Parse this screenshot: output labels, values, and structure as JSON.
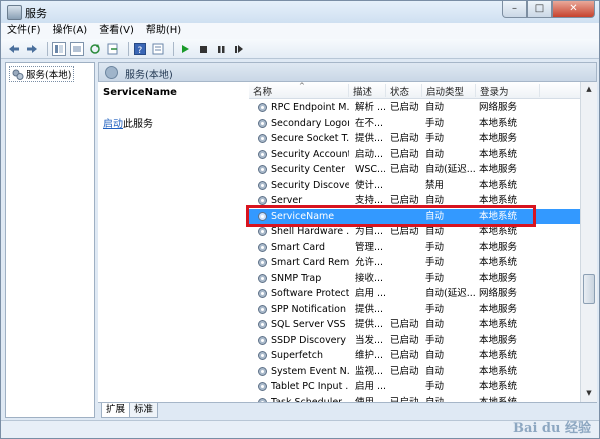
{
  "window": {
    "title": "服务",
    "min": "–",
    "max": "□",
    "close": "✕"
  },
  "menu": [
    "文件(F)",
    "操作(A)",
    "查看(V)",
    "帮助(H)"
  ],
  "toolbar_icons": [
    "back-icon",
    "forward-icon",
    "view-icon",
    "list-icon",
    "refresh-icon",
    "export-icon",
    "help-icon",
    "properties-icon",
    "play-icon",
    "stop-icon",
    "pause-icon",
    "restart-icon"
  ],
  "tree": {
    "root": "服务(本地)"
  },
  "right_header": "服务(本地)",
  "detail": {
    "service_name": "ServiceName",
    "start_link": "启动",
    "start_suffix": "此服务"
  },
  "columns": [
    "名称",
    "描述",
    "状态",
    "启动类型",
    "登录为"
  ],
  "rows": [
    {
      "name": "RPC Endpoint M...",
      "desc": "解析 ...",
      "status": "已启动",
      "type": "自动",
      "logon": "网络服务"
    },
    {
      "name": "Secondary Logon",
      "desc": "在不...",
      "status": "",
      "type": "手动",
      "logon": "本地系统"
    },
    {
      "name": "Secure Socket T...",
      "desc": "提供...",
      "status": "已启动",
      "type": "手动",
      "logon": "本地服务"
    },
    {
      "name": "Security Account...",
      "desc": "启动...",
      "status": "已启动",
      "type": "自动",
      "logon": "本地系统"
    },
    {
      "name": "Security Center",
      "desc": "WSC...",
      "status": "已启动",
      "type": "自动(延迟...",
      "logon": "本地服务"
    },
    {
      "name": "Security Discover...",
      "desc": "使计...",
      "status": "",
      "type": "禁用",
      "logon": "本地系统"
    },
    {
      "name": "Server",
      "desc": "支持...",
      "status": "已启动",
      "type": "自动",
      "logon": "本地系统"
    },
    {
      "name": "ServiceName",
      "desc": "",
      "status": "",
      "type": "自动",
      "logon": "本地系统",
      "selected": true
    },
    {
      "name": "Shell Hardware ...",
      "desc": "为自...",
      "status": "已启动",
      "type": "自动",
      "logon": "本地系统"
    },
    {
      "name": "Smart Card",
      "desc": "管理...",
      "status": "",
      "type": "手动",
      "logon": "本地服务"
    },
    {
      "name": "Smart Card Rem...",
      "desc": "允许...",
      "status": "",
      "type": "手动",
      "logon": "本地系统"
    },
    {
      "name": "SNMP Trap",
      "desc": "接收...",
      "status": "",
      "type": "手动",
      "logon": "本地服务"
    },
    {
      "name": "Software Protect...",
      "desc": "启用 ...",
      "status": "",
      "type": "自动(延迟...",
      "logon": "网络服务"
    },
    {
      "name": "SPP Notification ...",
      "desc": "提供...",
      "status": "",
      "type": "手动",
      "logon": "本地服务"
    },
    {
      "name": "SQL Server VSS ...",
      "desc": "提供...",
      "status": "已启动",
      "type": "自动",
      "logon": "本地系统"
    },
    {
      "name": "SSDP Discovery",
      "desc": "当发...",
      "status": "已启动",
      "type": "手动",
      "logon": "本地服务"
    },
    {
      "name": "Superfetch",
      "desc": "维护...",
      "status": "已启动",
      "type": "自动",
      "logon": "本地系统"
    },
    {
      "name": "System Event N...",
      "desc": "监视...",
      "status": "已启动",
      "type": "自动",
      "logon": "本地系统"
    },
    {
      "name": "Tablet PC Input ...",
      "desc": "启用 ...",
      "status": "",
      "type": "手动",
      "logon": "本地系统"
    },
    {
      "name": "Task Scheduler",
      "desc": "使用...",
      "status": "已启动",
      "type": "自动",
      "logon": "本地系统"
    }
  ],
  "tabs": [
    "扩展",
    "标准"
  ],
  "watermark": "Bai du 经验",
  "colors": {
    "selection": "#3399ff",
    "highlight_box": "#d8141f",
    "link": "#1f5fbf"
  }
}
